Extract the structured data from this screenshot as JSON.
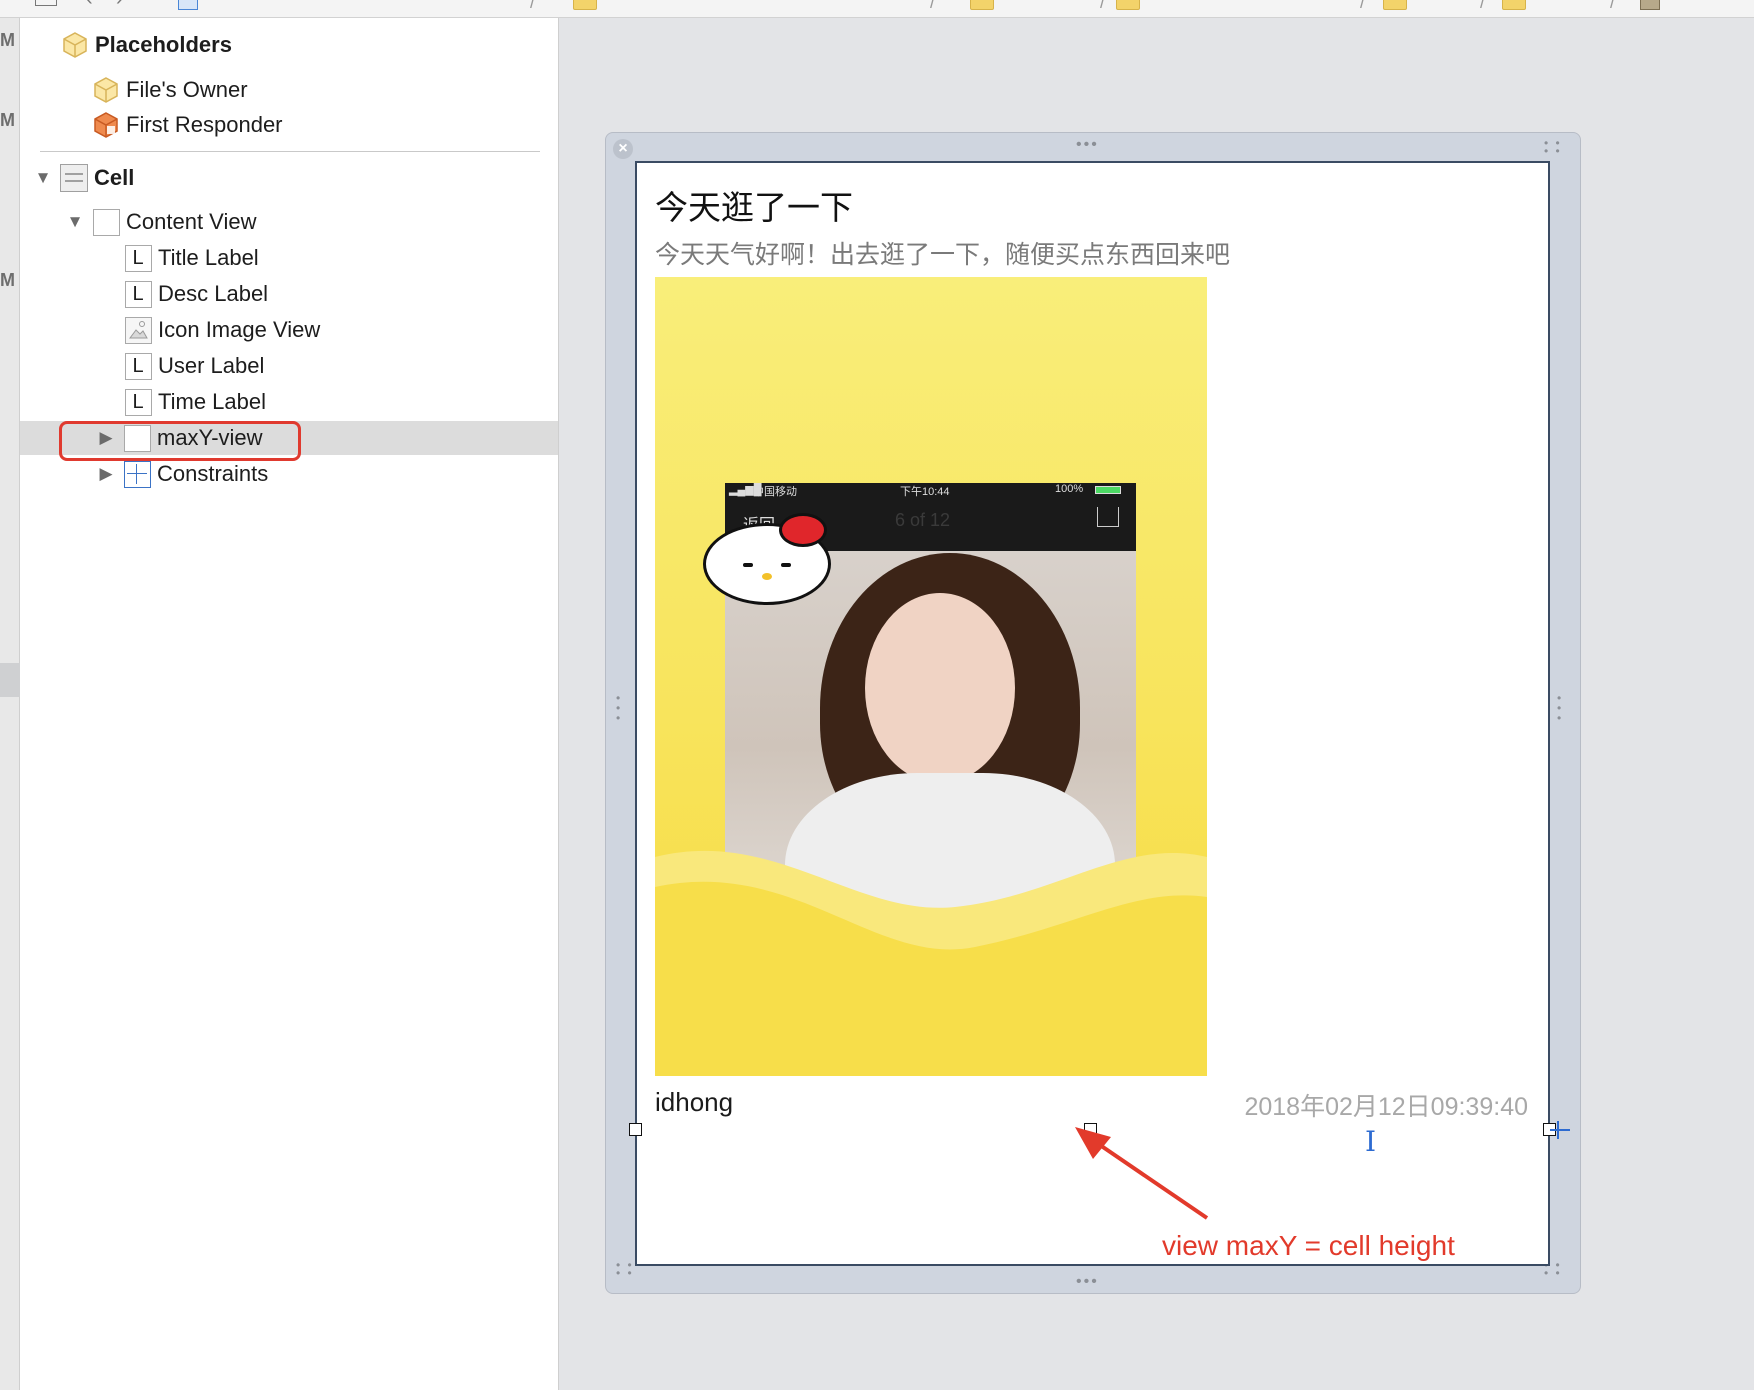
{
  "outline": {
    "placeholders_label": "Placeholders",
    "files_owner": "File's Owner",
    "first_responder": "First Responder",
    "cell": "Cell",
    "content_view": "Content View",
    "title_label": "Title Label",
    "desc_label": "Desc Label",
    "icon_image_view": "Icon Image View",
    "user_label": "User Label",
    "time_label": "Time Label",
    "maxy_view": "maxY-view",
    "constraints": "Constraints",
    "label_glyph": "L"
  },
  "cell_preview": {
    "title": "今天逛了一下",
    "desc": "今天天气好啊！出去逛了一下，随便买点东西回来吧",
    "user": "idhong",
    "time": "2018年02月12日09:39:40"
  },
  "phone_screenshot": {
    "status_carrier": "中国移动",
    "status_time": "下午10:44",
    "status_battery": "100%",
    "back": "返回",
    "page": "6 of 12"
  },
  "annotation": {
    "text": "view maxY = cell height"
  },
  "left_strip_letters": [
    "M",
    "M",
    "M"
  ],
  "colors": {
    "highlight": "#e03a2f",
    "selection": "#dcdcdc",
    "annotation": "#e23a2b"
  }
}
